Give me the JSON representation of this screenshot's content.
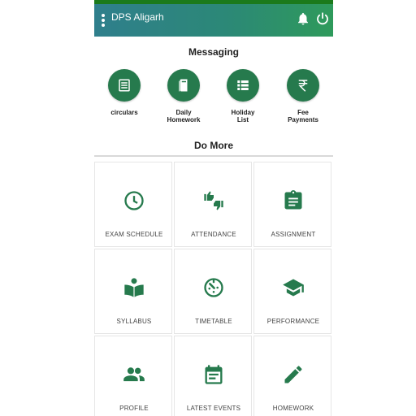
{
  "header": {
    "title": "DPS Aligarh",
    "icons": [
      "menu-dots-icon",
      "bell-icon",
      "power-icon"
    ]
  },
  "messaging": {
    "title": "Messaging",
    "items": [
      {
        "label": "circulars",
        "icon": "document-icon"
      },
      {
        "label": "Daily\nHomework",
        "icon": "book-icon"
      },
      {
        "label": "Holiday\nList",
        "icon": "list-icon"
      },
      {
        "label": "Fee\nPayments",
        "icon": "rupee-icon"
      }
    ]
  },
  "do_more": {
    "title": "Do More",
    "tiles": [
      {
        "label": "EXAM SCHEDULE",
        "icon": "clock-icon"
      },
      {
        "label": "ATTENDANCE",
        "icon": "thumbs-icon"
      },
      {
        "label": "ASSIGNMENT",
        "icon": "clipboard-icon"
      },
      {
        "label": "SYLLABUS",
        "icon": "reader-icon"
      },
      {
        "label": "TIMETABLE",
        "icon": "timer-icon"
      },
      {
        "label": "PERFORMANCE",
        "icon": "graduation-cap-icon"
      },
      {
        "label": "PROFILE",
        "icon": "people-icon"
      },
      {
        "label": "LATEST EVENTS",
        "icon": "calendar-icon"
      },
      {
        "label": "HOMEWORK",
        "icon": "pencil-icon"
      }
    ]
  },
  "colors": {
    "accent": "#267a4d",
    "status_bar": "#1b7a1b",
    "header_start": "#2f7f8c",
    "header_end": "#2e9a5b"
  }
}
